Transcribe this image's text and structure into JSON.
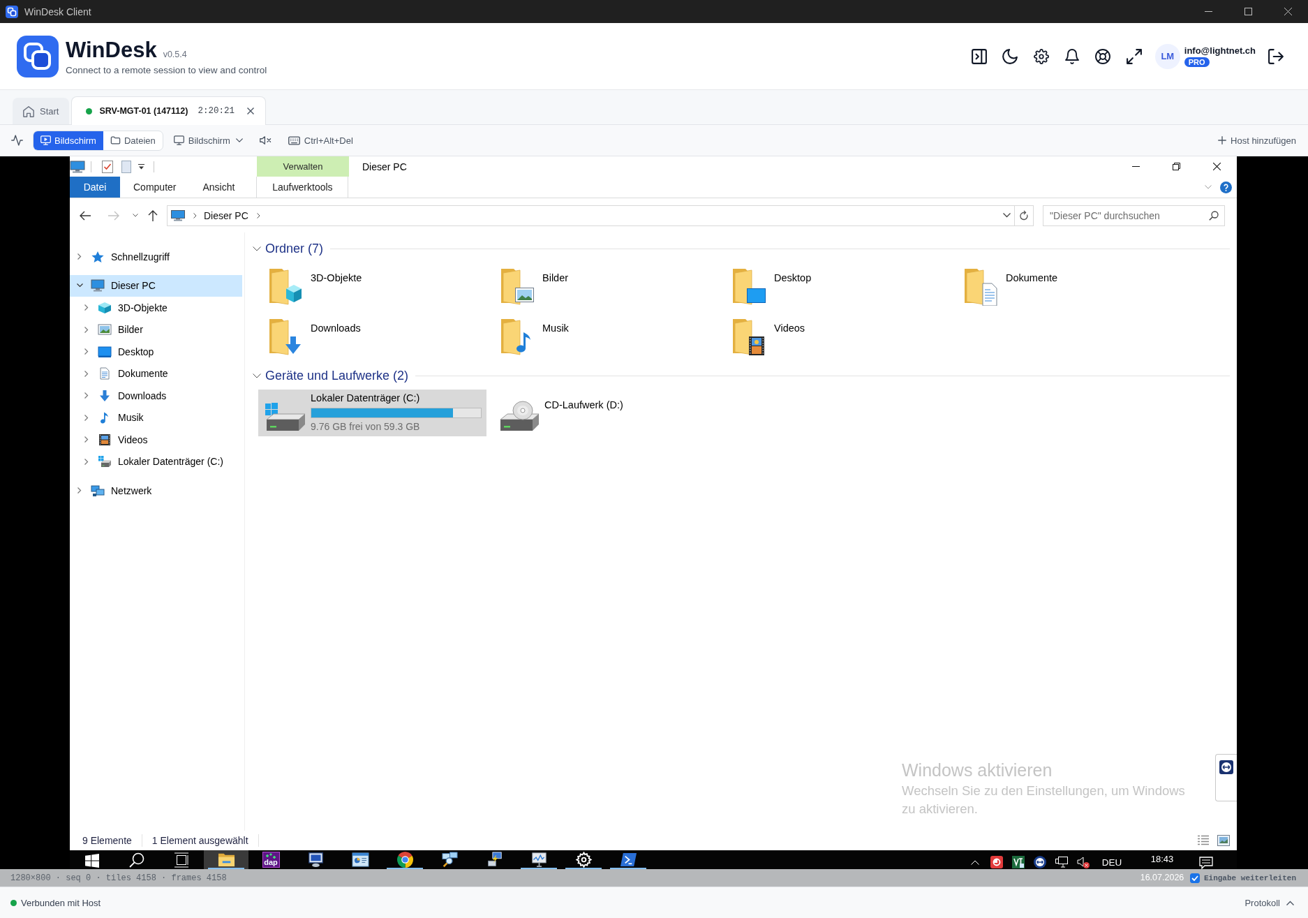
{
  "window": {
    "title": "WinDesk Client"
  },
  "header": {
    "app_name": "WinDesk",
    "version": "v0.5.4",
    "tagline": "Connect to a remote session to view and control",
    "user": {
      "initials": "LM",
      "email": "info@lightnet.ch",
      "plan": "PRO"
    }
  },
  "session_tabs": [
    {
      "label": "Start",
      "kind": "home",
      "selected": false
    },
    {
      "label": "SRV-MGT-01 (147112)",
      "kind": "session",
      "selected": true,
      "connected": true,
      "timer": "2:20:21"
    }
  ],
  "toolbar": {
    "view_modes": [
      {
        "label": "Bildschirm",
        "kind": "screen",
        "selected": true
      },
      {
        "label": "Dateien",
        "kind": "files",
        "selected": false
      }
    ],
    "monitor_select": {
      "label": "Bildschirm"
    },
    "audio_muted": true,
    "ctrl_alt_del": {
      "label": "Ctrl+Alt+Del"
    },
    "add_host": {
      "label": "Host hinzufügen"
    }
  },
  "remote_screen": {
    "explorer": {
      "title": "Dieser PC",
      "contextual_group": "Verwalten",
      "ribbon_tabs": [
        {
          "label": "Datei",
          "kind": "file"
        },
        {
          "label": "Computer",
          "kind": "tab"
        },
        {
          "label": "Ansicht",
          "kind": "tab"
        },
        {
          "label": "Laufwerktools",
          "kind": "contextual"
        }
      ],
      "address": {
        "path": [
          "Dieser PC"
        ]
      },
      "search": {
        "placeholder": "\"Dieser PC\" durchsuchen"
      },
      "navigation": [
        {
          "label": "Schnellzugriff",
          "kind": "quickaccess",
          "expanded": false,
          "selected": false
        },
        {
          "label": "Dieser PC",
          "kind": "computer",
          "expanded": true,
          "selected": true,
          "children": [
            {
              "label": "3D-Objekte",
              "kind": "objects",
              "expanded": false,
              "selected": false
            },
            {
              "label": "Bilder",
              "kind": "pictures",
              "expanded": false,
              "selected": false
            },
            {
              "label": "Desktop",
              "kind": "desktop",
              "expanded": false,
              "selected": false
            },
            {
              "label": "Dokumente",
              "kind": "documents",
              "expanded": false,
              "selected": false
            },
            {
              "label": "Downloads",
              "kind": "downloads",
              "expanded": false,
              "selected": false
            },
            {
              "label": "Musik",
              "kind": "music",
              "expanded": false,
              "selected": false
            },
            {
              "label": "Videos",
              "kind": "videos",
              "expanded": false,
              "selected": false
            },
            {
              "label": "Lokaler Datenträger (C:)",
              "kind": "system_drive",
              "expanded": false,
              "selected": false
            }
          ]
        },
        {
          "label": "Netzwerk",
          "kind": "network",
          "expanded": false,
          "selected": false
        }
      ],
      "sections": [
        {
          "title": "Ordner (7)",
          "kind": "folders",
          "expanded": true,
          "items": [
            {
              "name": "3D-Objekte",
              "kind": "objects",
              "selected": false
            },
            {
              "name": "Bilder",
              "kind": "pictures",
              "selected": false
            },
            {
              "name": "Desktop",
              "kind": "desktop",
              "selected": false
            },
            {
              "name": "Dokumente",
              "kind": "documents",
              "selected": false
            },
            {
              "name": "Downloads",
              "kind": "downloads",
              "selected": false
            },
            {
              "name": "Musik",
              "kind": "music",
              "selected": false
            },
            {
              "name": "Videos",
              "kind": "videos",
              "selected": false
            }
          ]
        },
        {
          "title": "Geräte und Laufwerke (2)",
          "kind": "devices",
          "expanded": true,
          "items": [
            {
              "name": "Lokaler Datenträger (C:)",
              "kind": "system_drive",
              "selected": true,
              "level": 0.835,
              "capacity": "9.76 GB frei von 59.3 GB"
            },
            {
              "name": "CD-Laufwerk (D:)",
              "kind": "cd_drive",
              "selected": false
            }
          ]
        }
      ],
      "status": {
        "item_count": "9 Elemente",
        "selection": "1 Element ausgewählt"
      }
    },
    "activation_notice": {
      "title": "Windows aktivieren",
      "text": "Wechseln Sie zu den Einstellungen, um Windows zu aktivieren."
    },
    "taskbar": {
      "apps": [
        {
          "kind": "explorer",
          "running": true,
          "selected": true
        },
        {
          "kind": "dap",
          "label": "dap",
          "running": false,
          "selected": false
        },
        {
          "kind": "remote",
          "running": false,
          "selected": false
        },
        {
          "kind": "dashboard",
          "running": false,
          "selected": false
        },
        {
          "kind": "browser",
          "running": true,
          "selected": false
        },
        {
          "kind": "network_search",
          "running": false,
          "selected": false
        },
        {
          "kind": "network_pc",
          "running": false,
          "selected": false
        },
        {
          "kind": "monitor_chart",
          "running": true,
          "selected": false
        },
        {
          "kind": "settings",
          "running": true,
          "selected": false
        },
        {
          "kind": "terminal",
          "running": true,
          "selected": false
        }
      ],
      "language": "DEU",
      "time": "18:43",
      "date": "16.07.2026"
    },
    "overlay": {
      "stats": "1280×800 · seq 0 · tiles 4158 · frames 4158",
      "forward_input": {
        "label": "Eingabe weiterleiten",
        "checked": true
      }
    }
  },
  "status_bar": {
    "connected": true,
    "text": "Verbunden mit Host",
    "log_button": "Protokoll"
  }
}
